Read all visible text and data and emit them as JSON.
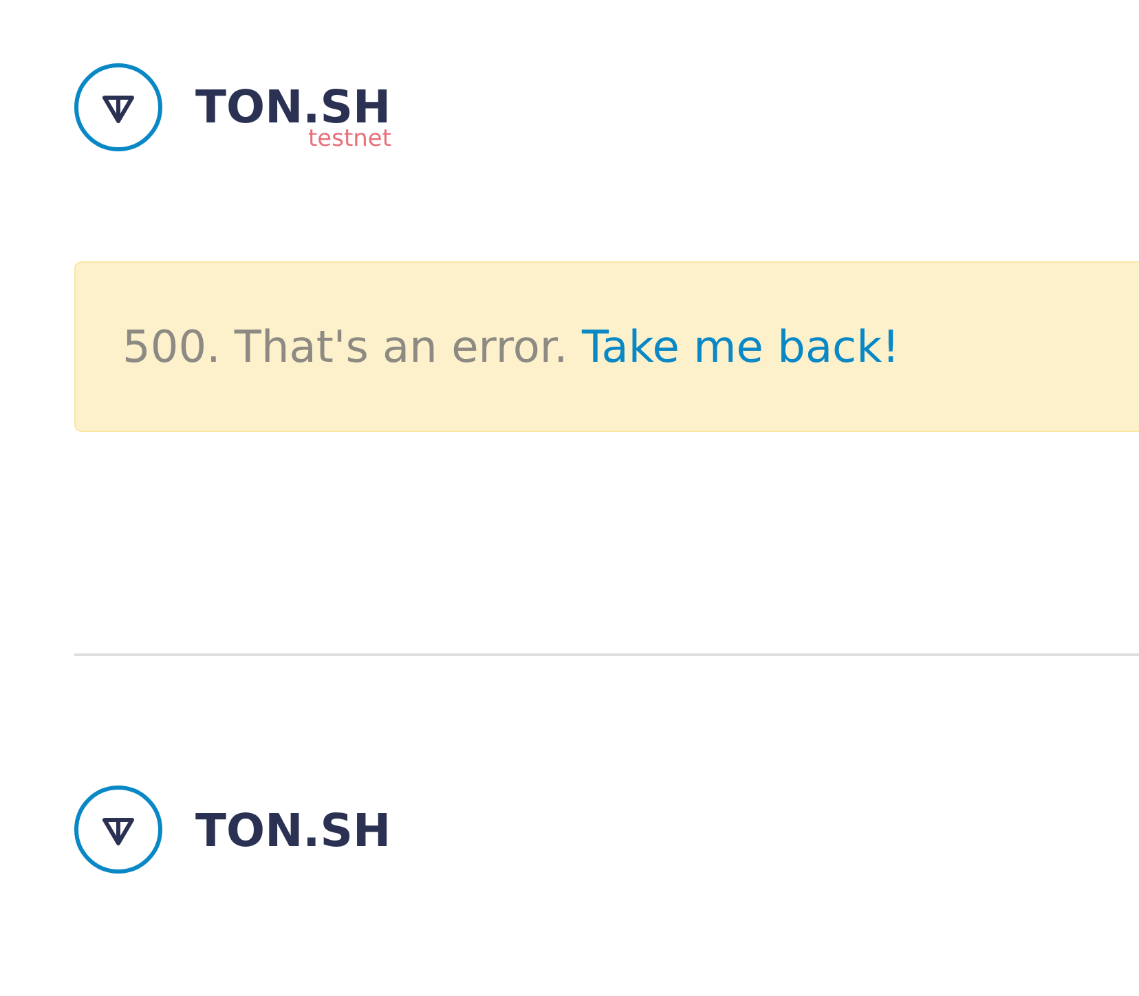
{
  "header": {
    "logo_text": "TON.SH",
    "network": "testnet"
  },
  "alert": {
    "message": "500. That's an error.",
    "link": "Take me back!"
  },
  "footer": {
    "logo_text": "TON.SH"
  }
}
